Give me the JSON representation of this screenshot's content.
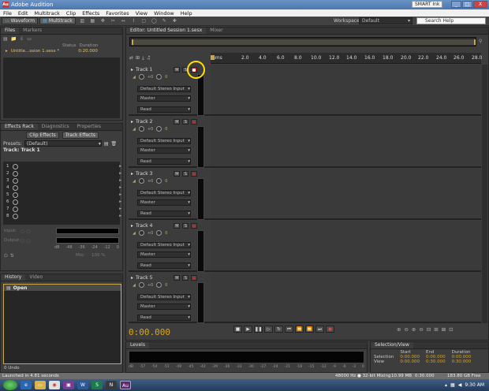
{
  "window": {
    "title": "Adobe Audition",
    "smart_ink": "SMART Ink",
    "minimize": "_",
    "maximize": "□",
    "close": "X",
    "app_icon": "Au"
  },
  "menu": [
    "File",
    "Edit",
    "Multitrack",
    "Clip",
    "Effects",
    "Favorites",
    "View",
    "Window",
    "Help"
  ],
  "toolbar": {
    "waveform": "Waveform",
    "multitrack": "Multitrack",
    "workspace_label": "Workspace:",
    "workspace_value": "Default",
    "search_placeholder": "Search Help"
  },
  "files_panel": {
    "tabs": [
      "Files",
      "Markers"
    ],
    "col_status": "Status",
    "col_duration": "Duration",
    "file_name": "Untitle...ssion 1.sesx *",
    "file_duration": "0:20.000"
  },
  "effects_rack": {
    "tabs": [
      "Effects Rack",
      "Diagnostics",
      "Properties"
    ],
    "clip_effects": "Clip Effects",
    "track_effects": "Track Effects",
    "presets_label": "Presets:",
    "presets_value": "(Default)",
    "track_label": "Track: Track 1",
    "slots": [
      "1",
      "2",
      "3",
      "4",
      "5",
      "6",
      "7",
      "8"
    ],
    "input_label": "Input:",
    "output_label": "Output:",
    "meter_scale": [
      "dB",
      "-48",
      "-36",
      "-24",
      "-12",
      "0"
    ],
    "mix_label": "Mix:",
    "mix_value": "100 %"
  },
  "history_panel": {
    "tabs": [
      "History",
      "Video"
    ],
    "open_item": "Open",
    "undo_count": "0 Undo"
  },
  "editor": {
    "tabs": [
      "Editor: Untitled Session 1.sesx",
      "Mixer"
    ],
    "ruler_first": "hms",
    "ruler": [
      "2.0",
      "4.0",
      "6.0",
      "8.0",
      "10.0",
      "12.0",
      "14.0",
      "16.0",
      "18.0",
      "20.0",
      "22.0",
      "24.0",
      "26.0",
      "28.0"
    ],
    "time_display": "0:00.000"
  },
  "tracks": [
    {
      "name": "Track 1",
      "m": "M",
      "s": "S",
      "vol": "+0",
      "pan": "0",
      "input": "Default Stereo Input",
      "output": "Master",
      "read": "Read"
    },
    {
      "name": "Track 2",
      "m": "M",
      "s": "S",
      "vol": "+0",
      "pan": "0",
      "input": "Default Stereo Input",
      "output": "Master",
      "read": "Read"
    },
    {
      "name": "Track 3",
      "m": "M",
      "s": "S",
      "vol": "+0",
      "pan": "0",
      "input": "Default Stereo Input",
      "output": "Master",
      "read": "Read"
    },
    {
      "name": "Track 4",
      "m": "M",
      "s": "S",
      "vol": "+0",
      "pan": "0",
      "input": "Default Stereo Input",
      "output": "Master",
      "read": "Read"
    },
    {
      "name": "Track 5",
      "m": "M",
      "s": "S",
      "vol": "+0",
      "pan": "0",
      "input": "Default Stereo Input",
      "output": "Master",
      "read": "Read"
    }
  ],
  "levels_panel": {
    "title": "Levels",
    "scale": [
      "dB",
      "-57",
      "-54",
      "-51",
      "-48",
      "-45",
      "-42",
      "-39",
      "-36",
      "-33",
      "-30",
      "-27",
      "-24",
      "-21",
      "-18",
      "-15",
      "-12",
      "-9",
      "-6",
      "-3",
      "0"
    ]
  },
  "selection_panel": {
    "title": "Selection/View",
    "col_start": "Start",
    "col_end": "End",
    "col_duration": "Duration",
    "row_selection": "Selection",
    "row_view": "View",
    "sel_start": "0:00.000",
    "sel_end": "0:00.000",
    "sel_duration": "0:00.000",
    "view_start": "0:00.000",
    "view_end": "0:30.000",
    "view_duration": "0:30.000"
  },
  "status": {
    "left": "Launched in 4.81 seconds",
    "sample": "48000 Hz ● 32-bit Mixing",
    "size": "10.99 MB",
    "time": "0:30.000",
    "free": "183.80 GB Free"
  },
  "taskbar": {
    "clock": "9:30 AM"
  },
  "colors": {
    "highlight_circle": "#ffe000",
    "record_red": "#cc3333",
    "playhead": "#c9a84a"
  }
}
